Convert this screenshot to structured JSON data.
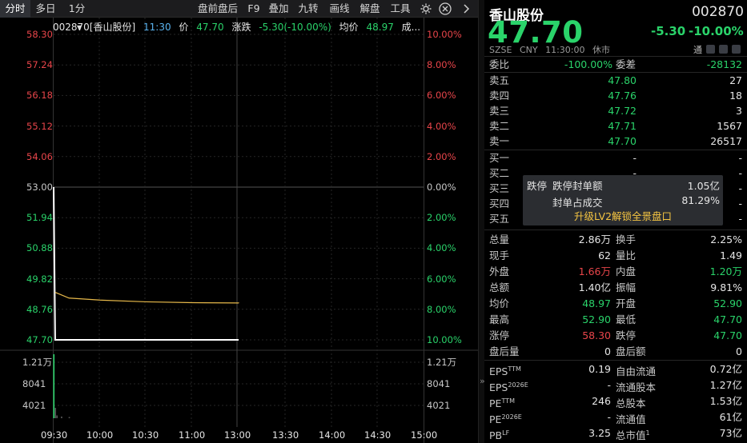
{
  "toolbar": {
    "tabs": [
      "分时",
      "多日"
    ],
    "period": "1分",
    "items": [
      "盘前盘后",
      "F9",
      "叠加",
      "九转",
      "画线",
      "解盘",
      "工具"
    ]
  },
  "chart_header": {
    "code_name": "002870[香山股份]",
    "time": "11:30",
    "price_label": "价",
    "price": "47.70",
    "change_label": "涨跌",
    "change": "-5.30(-10.00%)",
    "avg_label": "均价",
    "avg": "48.97",
    "more": "成..."
  },
  "price_axis": {
    "left": [
      "58.30",
      "57.24",
      "56.18",
      "55.12",
      "54.06",
      "53.00",
      "51.94",
      "50.88",
      "49.82",
      "48.76",
      "47.70"
    ],
    "right": [
      "10.00%",
      "8.00%",
      "6.00%",
      "4.00%",
      "2.00%",
      "0.00%",
      "2.00%",
      "4.00%",
      "6.00%",
      "8.00%",
      "10.00%"
    ]
  },
  "volume_axis": {
    "left": [
      "1.21万",
      "8041",
      "4021"
    ],
    "right": [
      "1.21万",
      "8041",
      "4021"
    ]
  },
  "time_axis": [
    "09:30",
    "10:00",
    "10:30",
    "11:00",
    "13:00",
    "13:30",
    "14:00",
    "14:30",
    "15:00"
  ],
  "chart_data": {
    "type": "line",
    "x_range": [
      "09:30",
      "15:00"
    ],
    "ylim": [
      47.7,
      58.3
    ],
    "prev_close": 53.0,
    "series": [
      {
        "name": "价",
        "x": [
          "09:30",
          "09:31",
          "11:30",
          "13:00"
        ],
        "values": [
          53.0,
          47.7,
          47.7,
          47.7
        ]
      },
      {
        "name": "均价",
        "x": [
          "09:31",
          "09:40",
          "10:00",
          "10:30",
          "11:00",
          "11:30",
          "13:00"
        ],
        "values": [
          49.35,
          49.15,
          49.08,
          49.02,
          48.99,
          48.98,
          48.97
        ]
      }
    ],
    "volume": {
      "ylim": [
        0,
        16082
      ],
      "x": [
        "09:30",
        "09:31",
        "09:32",
        "09:35",
        "09:40"
      ],
      "values": [
        16082,
        2600,
        700,
        420,
        300
      ]
    }
  },
  "quote": {
    "name": "香山股份",
    "code": "002870",
    "price": "47.70",
    "change": "-5.30",
    "change_pct": "-10.00%",
    "market": "SZSE",
    "currency": "CNY",
    "time": "11:30:00",
    "status": "休市",
    "tong": "通"
  },
  "order_ratio": {
    "label": "委比",
    "value": "-100.00%",
    "diff_label": "委差",
    "diff": "-28132"
  },
  "asks": [
    {
      "label": "卖五",
      "price": "47.80",
      "vol": "27"
    },
    {
      "label": "卖四",
      "price": "47.76",
      "vol": "18"
    },
    {
      "label": "卖三",
      "price": "47.72",
      "vol": "3"
    },
    {
      "label": "卖二",
      "price": "47.71",
      "vol": "1567"
    },
    {
      "label": "卖一",
      "price": "47.70",
      "vol": "26517"
    }
  ],
  "bids": [
    {
      "label": "买一",
      "price": "-",
      "vol": "-"
    },
    {
      "label": "买二",
      "price": "-",
      "vol": "-"
    },
    {
      "label": "买三",
      "price": "-",
      "vol": "-"
    },
    {
      "label": "买四",
      "price": "-",
      "vol": "-"
    },
    {
      "label": "买五",
      "price": "-",
      "vol": "-"
    }
  ],
  "limit_box": {
    "tag": "跌停",
    "seal_label": "跌停封单额",
    "seal_value": "1.05亿",
    "ratio_label": "封单占成交",
    "ratio_value": "81.29%",
    "upgrade": "升级LV2解锁全景盘口"
  },
  "stats": [
    {
      "l1": "总量",
      "v1": "2.86万",
      "c1": "w",
      "l2": "换手",
      "v2": "2.25%",
      "c2": "w"
    },
    {
      "l1": "现手",
      "v1": "62",
      "c1": "w",
      "l2": "量比",
      "v2": "1.49",
      "c2": "w"
    },
    {
      "l1": "外盘",
      "v1": "1.66万",
      "c1": "r",
      "l2": "内盘",
      "v2": "1.20万",
      "c2": "g"
    },
    {
      "l1": "总额",
      "v1": "1.40亿",
      "c1": "w",
      "l2": "振幅",
      "v2": "9.81%",
      "c2": "w"
    },
    {
      "l1": "均价",
      "v1": "48.97",
      "c1": "g",
      "l2": "开盘",
      "v2": "52.90",
      "c2": "g"
    },
    {
      "l1": "最高",
      "v1": "52.90",
      "c1": "g",
      "l2": "最低",
      "v2": "47.70",
      "c2": "g"
    },
    {
      "l1": "涨停",
      "v1": "58.30",
      "c1": "r",
      "l2": "跌停",
      "v2": "47.70",
      "c2": "g"
    },
    {
      "l1": "盘后量",
      "v1": "0",
      "c1": "w",
      "l2": "盘后额",
      "v2": "0",
      "c2": "w"
    }
  ],
  "fundamentals": [
    {
      "l1": "EPS",
      "s1": "TTM",
      "v1": "0.19",
      "l2": "自由流通",
      "s2": "",
      "v2": "0.72亿"
    },
    {
      "l1": "EPS",
      "s1": "2026E",
      "v1": "-",
      "l2": "流通股本",
      "s2": "",
      "v2": "1.27亿"
    },
    {
      "l1": "PE",
      "s1": "TTM",
      "v1": "246",
      "l2": "总股本",
      "s2": "",
      "v2": "1.53亿"
    },
    {
      "l1": "PE",
      "s1": "2026E",
      "v1": "-",
      "l2": "流通值",
      "s2": "",
      "v2": "61亿"
    },
    {
      "l1": "PB",
      "s1": "LF",
      "v1": "3.25",
      "l2": "总市值",
      "s2": "1",
      "v2": "73亿"
    }
  ],
  "colors": {
    "up": "#e8454a",
    "down": "#2ad36a",
    "avg_line": "#e6b84a",
    "price_line": "#ffffff",
    "panel": "#2b2d31"
  }
}
